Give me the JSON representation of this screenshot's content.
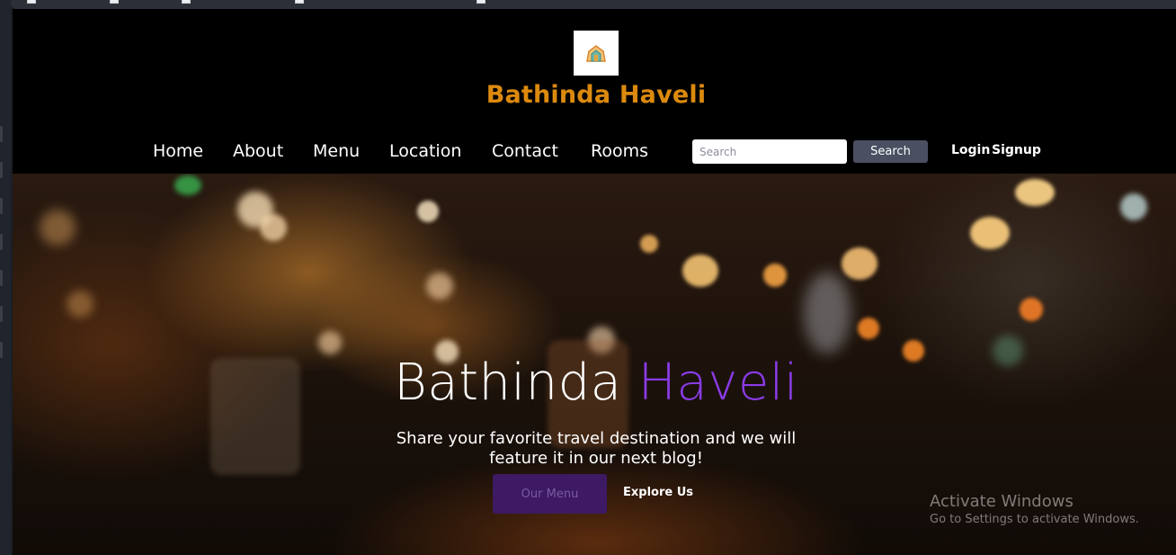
{
  "header": {
    "logo": "restaurant-logo",
    "brand": "Bathinda Haveli",
    "brand_color": "#dc8a0e"
  },
  "nav": {
    "links": [
      "Home",
      "About",
      "Menu",
      "Location",
      "Contact",
      "Rooms"
    ],
    "search_placeholder": "Search",
    "search_button": "Search",
    "login": "Login",
    "signup": "Signup"
  },
  "hero": {
    "title_part1": "Bathinda",
    "title_part2": "Haveli",
    "accent_color": "#8a3be6",
    "subtitle": "Share your favorite travel destination and we will feature it in our next blog!",
    "menu_button": "Our Menu",
    "explore_link": "Explore Us"
  },
  "watermark": {
    "line1": "Activate Windows",
    "line2": "Go to Settings to activate Windows."
  }
}
